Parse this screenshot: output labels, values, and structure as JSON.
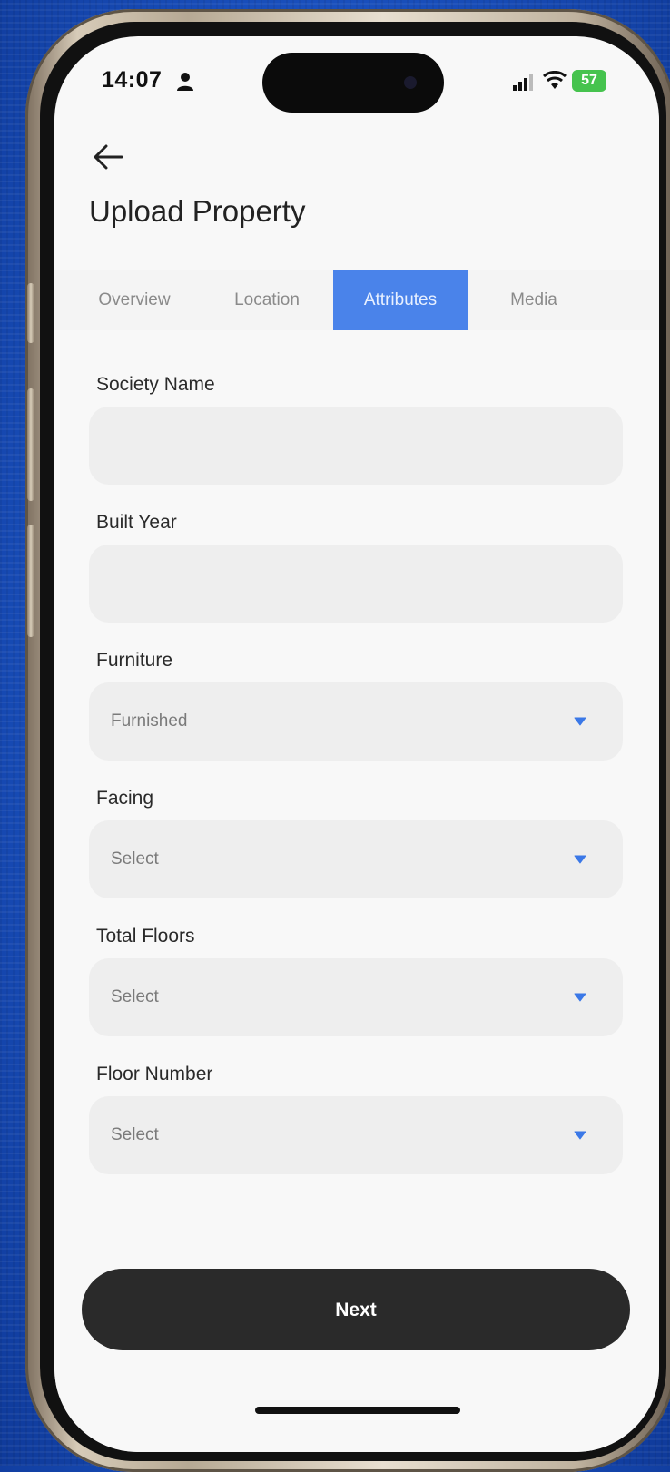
{
  "status_bar": {
    "time": "14:07",
    "battery": "57",
    "battery_color": "#46c34e"
  },
  "header": {
    "title": "Upload Property"
  },
  "tabs": [
    {
      "label": "Overview",
      "active": false
    },
    {
      "label": "Location",
      "active": false
    },
    {
      "label": "Attributes",
      "active": true
    },
    {
      "label": "Media",
      "active": false
    }
  ],
  "form": {
    "society_name": {
      "label": "Society Name",
      "value": ""
    },
    "built_year": {
      "label": "Built Year",
      "value": ""
    },
    "furniture": {
      "label": "Furniture",
      "value": "Furnished"
    },
    "facing": {
      "label": "Facing",
      "value": "Select"
    },
    "total_floors": {
      "label": "Total Floors",
      "value": "Select"
    },
    "floor_number": {
      "label": "Floor Number",
      "value": "Select"
    }
  },
  "actions": {
    "next_label": "Next"
  },
  "colors": {
    "accent": "#4a83ea",
    "button": "#2a2a2a"
  }
}
